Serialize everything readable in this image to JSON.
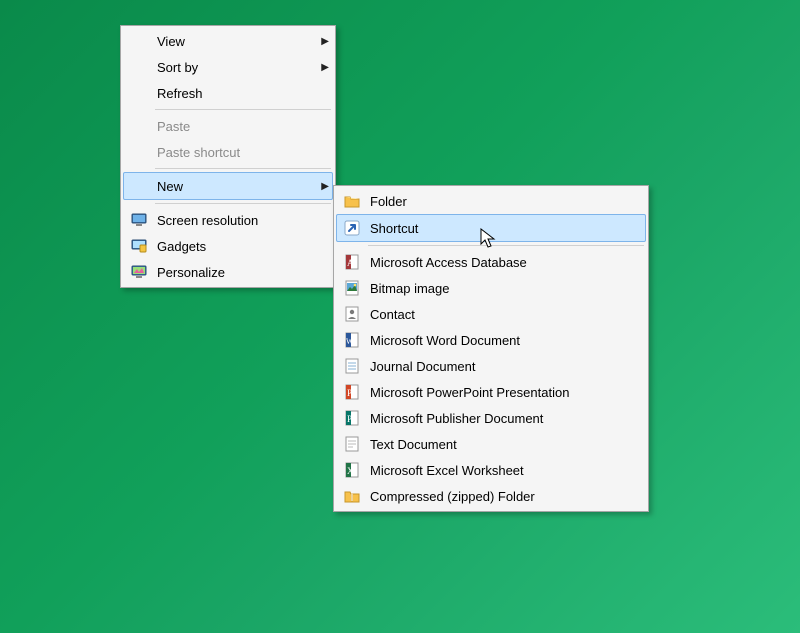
{
  "context_menu": {
    "items": [
      {
        "label": "View",
        "submenu": true,
        "enabled": true,
        "icon": null
      },
      {
        "label": "Sort by",
        "submenu": true,
        "enabled": true,
        "icon": null
      },
      {
        "label": "Refresh",
        "submenu": false,
        "enabled": true,
        "icon": null
      },
      {
        "separator": true
      },
      {
        "label": "Paste",
        "submenu": false,
        "enabled": false,
        "icon": null
      },
      {
        "label": "Paste shortcut",
        "submenu": false,
        "enabled": false,
        "icon": null
      },
      {
        "separator": true
      },
      {
        "label": "New",
        "submenu": true,
        "enabled": true,
        "highlight": true,
        "icon": null
      },
      {
        "separator": true
      },
      {
        "label": "Screen resolution",
        "submenu": false,
        "enabled": true,
        "icon": "monitor"
      },
      {
        "label": "Gadgets",
        "submenu": false,
        "enabled": true,
        "icon": "gadget"
      },
      {
        "label": "Personalize",
        "submenu": false,
        "enabled": true,
        "icon": "personalize"
      }
    ]
  },
  "new_submenu": {
    "items": [
      {
        "label": "Folder",
        "icon": "folder"
      },
      {
        "label": "Shortcut",
        "icon": "shortcut",
        "highlight": true
      },
      {
        "separator": true
      },
      {
        "label": "Microsoft Access Database",
        "icon": "access"
      },
      {
        "label": "Bitmap image",
        "icon": "bitmap"
      },
      {
        "label": "Contact",
        "icon": "contact"
      },
      {
        "label": "Microsoft Word Document",
        "icon": "word"
      },
      {
        "label": "Journal Document",
        "icon": "journal"
      },
      {
        "label": "Microsoft PowerPoint Presentation",
        "icon": "powerpoint"
      },
      {
        "label": "Microsoft Publisher Document",
        "icon": "publisher"
      },
      {
        "label": "Text Document",
        "icon": "text"
      },
      {
        "label": "Microsoft Excel Worksheet",
        "icon": "excel"
      },
      {
        "label": "Compressed (zipped) Folder",
        "icon": "zip"
      }
    ]
  },
  "colors": {
    "highlight_bg": "#cde8ff",
    "highlight_border": "#7eb4ea",
    "menu_bg": "#f5f5f5",
    "menu_border": "#a6a6a6",
    "disabled_text": "#8a8a8a"
  }
}
